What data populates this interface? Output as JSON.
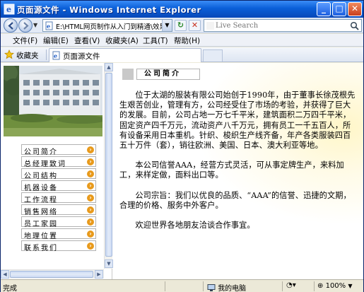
{
  "window": {
    "title": "页面源文件 - Windows Internet Explorer"
  },
  "address": {
    "url": "E:\\HTML网页制作从入门到精通\\效果",
    "search_placeholder": "Live Search"
  },
  "menu": [
    "文件(F)",
    "编辑(E)",
    "查看(V)",
    "收藏夹(A)",
    "工具(T)",
    "帮助(H)"
  ],
  "favorites": {
    "label": "收藏夹"
  },
  "tab": {
    "label": "页面源文件"
  },
  "nav": {
    "items": [
      "公司简介",
      "总经理致词",
      "公司结构",
      "机器设备",
      "工作流程",
      "销售网络",
      "员工家园",
      "地理位置",
      "联系我们"
    ]
  },
  "article": {
    "heading": "公司简介",
    "paragraphs": [
      "位于太湖的服装有限公司始创于1990年，由于董事长徐茂根先生艰苦创业，管理有方，公司经受住了市场的考验，并获得了巨大的发展。目前，公司占地一万七千平米，建筑面积二万四千平米，固定资产四千万元，流动资产八千万元，拥有员工一千五百人，所有设备采用日本重机。针织、梭织生产线齐备，年产各类服装四百五十万件（套），销往欧洲、美国、日本、澳大利亚等地。",
      "本公司信誉AAA，经营方式灵活，可从事定牌生产，来料加工，来样定做，面料出口等。",
      "公司宗旨：我们以优良的品质、“AAA”的信誉、迅捷的文期，合理的价格、服务中外客户。",
      "欢迎世界各地朋友洽谈合作事宜。"
    ]
  },
  "status": {
    "left": "完成",
    "zone": "我的电脑",
    "zoom": "100%"
  },
  "colors": {
    "titlebar": "#0a5fd8",
    "nav_arrow": "#e89a1c"
  }
}
